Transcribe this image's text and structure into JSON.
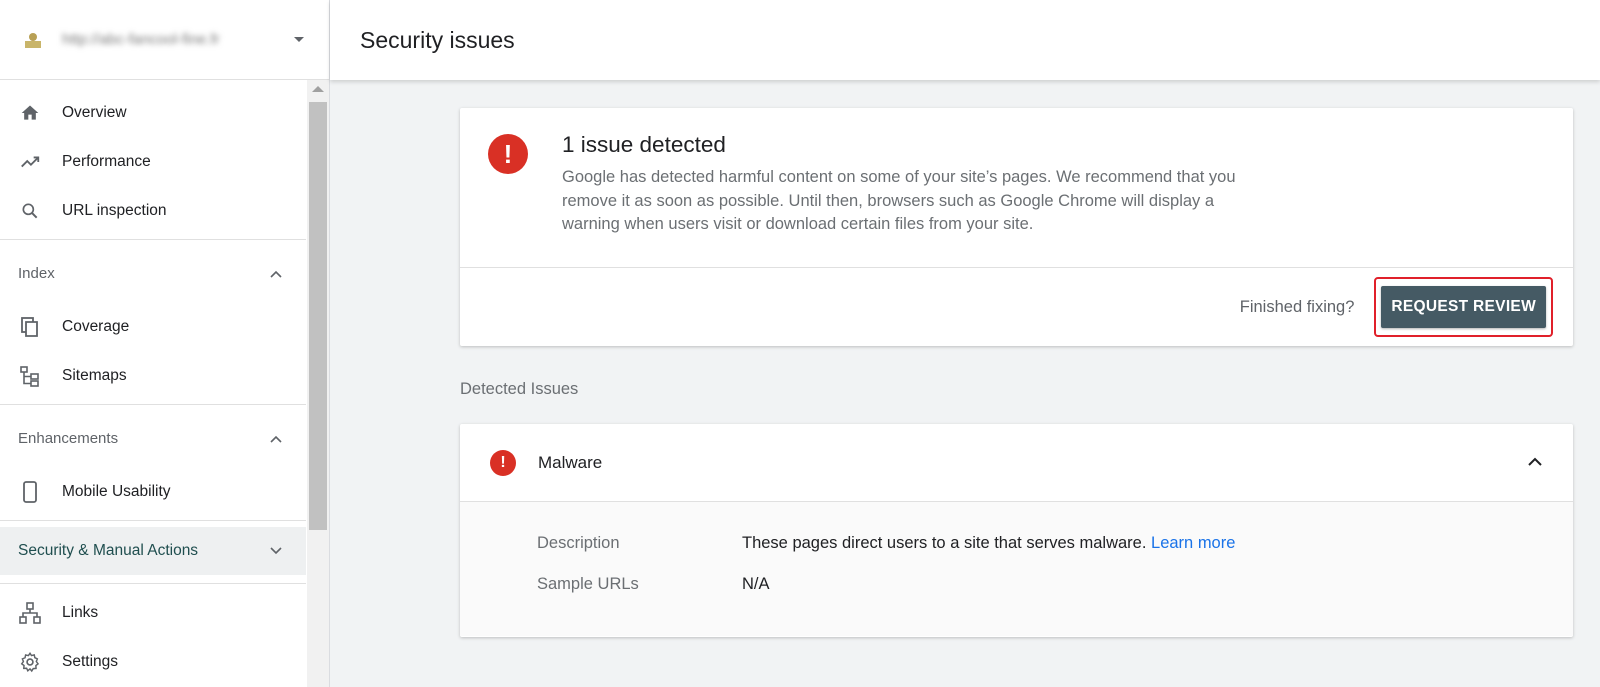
{
  "header": {
    "title": "Security issues"
  },
  "property": {
    "url": "http://abc-fancool-fine.fr"
  },
  "sidebar": {
    "items_top": [
      {
        "label": "Overview"
      },
      {
        "label": "Performance"
      },
      {
        "label": "URL inspection"
      }
    ],
    "index": {
      "heading": "Index",
      "items": [
        {
          "label": "Coverage"
        },
        {
          "label": "Sitemaps"
        }
      ]
    },
    "enhancements": {
      "heading": "Enhancements",
      "items": [
        {
          "label": "Mobile Usability"
        }
      ]
    },
    "security": {
      "label": "Security & Manual Actions"
    },
    "items_bottom": [
      {
        "label": "Links"
      },
      {
        "label": "Settings"
      }
    ]
  },
  "issue": {
    "title": "1 issue detected",
    "description": "Google has detected harmful content on some of your site’s pages. We recommend that you remove it as soon as possible. Until then, browsers such as Google Chrome will display a warning when users visit or download certain files from your site.",
    "finished_label": "Finished fixing?",
    "button_label": "REQUEST REVIEW"
  },
  "detected": {
    "label": "Detected Issues",
    "malware": {
      "title": "Malware",
      "description_key": "Description",
      "description_value": "These pages direct users to a site that serves malware.",
      "learn_more": "Learn more",
      "samples_key": "Sample URLs",
      "samples_value": "N/A"
    }
  },
  "colors": {
    "error": "#d93025",
    "button": "#455a64",
    "highlight": "#e0202a",
    "link": "#1a73e8"
  }
}
